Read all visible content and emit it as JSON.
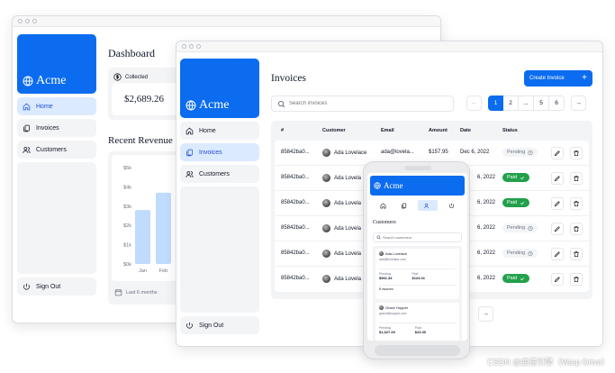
{
  "brand": {
    "name": "Acme",
    "color": "#0b6cf0"
  },
  "back_window": {
    "nav": [
      {
        "label": "Home",
        "icon": "home-icon",
        "active": true
      },
      {
        "label": "Invoices",
        "icon": "invoices-icon",
        "active": false
      },
      {
        "label": "Customers",
        "icon": "customers-icon",
        "active": false
      }
    ],
    "sign_out": "Sign Out",
    "title": "Dashboard",
    "card": {
      "label": "Collected",
      "value": "$2,689.26"
    },
    "revenue_title": "Recent Revenue",
    "chart_data": {
      "type": "bar",
      "categories": [
        "Jan",
        "Feb"
      ],
      "values": [
        2800,
        3700
      ],
      "yticks": [
        "$5k",
        "$4k",
        "$3k",
        "$2k",
        "$1k",
        "$0k"
      ],
      "ylim": [
        0,
        5000
      ]
    },
    "chart_footer": "Last 6 months"
  },
  "main_window": {
    "nav": [
      {
        "label": "Home",
        "icon": "home-icon",
        "active": false
      },
      {
        "label": "Invoices",
        "icon": "invoices-icon",
        "active": true
      },
      {
        "label": "Customers",
        "icon": "customers-icon",
        "active": false
      }
    ],
    "sign_out": "Sign Out",
    "title": "Invoices",
    "create_button": "Create Invoice",
    "search_placeholder": "Search invoices",
    "pagination": [
      "1",
      "2",
      "...",
      "5",
      "6"
    ],
    "table": {
      "headers": [
        "#",
        "Customer",
        "Email",
        "Amount",
        "Date",
        "Status"
      ],
      "rows": [
        {
          "id": "85842ba0...",
          "customer": "Ada Lovelace",
          "email": "ada@lovela...",
          "amount": "$157.95",
          "date": "Dec 6, 2022",
          "status": "Pending"
        },
        {
          "id": "85842ba0...",
          "customer": "Ada Lovela",
          "email": "",
          "amount": "",
          "date": "6, 2022",
          "status": "Paid"
        },
        {
          "id": "85842ba0...",
          "customer": "Ada Lovela",
          "email": "",
          "amount": "",
          "date": "6, 2022",
          "status": "Paid"
        },
        {
          "id": "85842ba0...",
          "customer": "Ada Lovela",
          "email": "",
          "amount": "",
          "date": "6, 2022",
          "status": "Pending"
        },
        {
          "id": "85842ba0...",
          "customer": "Ada Lovela",
          "email": "",
          "amount": "",
          "date": "6, 2022",
          "status": "Pending"
        },
        {
          "id": "85842ba0...",
          "customer": "Ada Lovela",
          "email": "",
          "amount": "",
          "date": "6, 2022",
          "status": "Paid"
        }
      ]
    }
  },
  "phone": {
    "brand": "Acme",
    "title": "Customers",
    "search_placeholder": "Search customers",
    "cards": [
      {
        "name": "Ada Lovelace",
        "email": "ada@lovelace.com",
        "pending_label": "Pending",
        "pending": "$561.34",
        "paid_label": "Paid",
        "paid": "$124.01",
        "invoices": "8 invoices"
      },
      {
        "name": "Grace Hopper",
        "email": "grace@hopper.com",
        "pending_label": "Pending",
        "pending": "$1,327.00",
        "paid_label": "Paid",
        "paid": "$23.00",
        "invoices": ""
      }
    ]
  },
  "watermark": "CSDN @曲速引擎（Warp Drive）"
}
